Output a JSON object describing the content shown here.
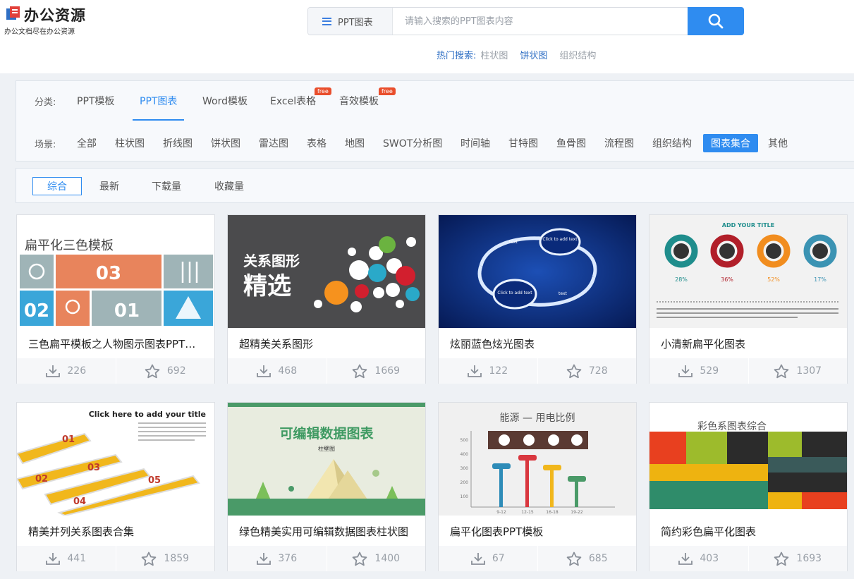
{
  "site": {
    "name": "办公资源",
    "slogan": "办公文档尽在办公资源"
  },
  "search": {
    "category": "PPT图表",
    "placeholder": "请输入搜索的PPT图表内容"
  },
  "hot": {
    "label": "热门搜索:",
    "items": [
      "柱状图",
      "饼状图",
      "组织结构"
    ],
    "active": "饼状图"
  },
  "filter": {
    "category_label": "分类:",
    "categories": [
      "PPT模板",
      "PPT图表",
      "Word模板",
      "Excel表格",
      "音效模板"
    ],
    "active_category": "PPT图表",
    "free_badge": "free",
    "scene_label": "场景:",
    "scenes": [
      "全部",
      "柱状图",
      "折线图",
      "饼状图",
      "雷达图",
      "表格",
      "地图",
      "SWOT分析图",
      "时间轴",
      "甘特图",
      "鱼骨图",
      "流程图",
      "组织结构",
      "图表集合",
      "其他"
    ],
    "active_scene": "图表集合"
  },
  "sort": {
    "options": [
      "综合",
      "最新",
      "下载量",
      "收藏量"
    ],
    "active": "综合"
  },
  "cards": [
    {
      "title": "三色扁平模板之人物图示图表PPT模板",
      "downloads": "226",
      "favorites": "692",
      "thumb_text": [
        "扁平化三色模板",
        "03",
        "02",
        "01"
      ]
    },
    {
      "title": "超精美关系图形",
      "downloads": "468",
      "favorites": "1669",
      "thumb_text": [
        "关系图形",
        "精选"
      ]
    },
    {
      "title": "炫丽蓝色炫光图表",
      "downloads": "122",
      "favorites": "728",
      "thumb_text": [
        "Click to add text",
        "text",
        "Click to add text",
        "text"
      ]
    },
    {
      "title": "小清新扁平化图表",
      "downloads": "529",
      "favorites": "1307",
      "thumb_text": [
        "ADD YOUR TITLE",
        "28%",
        "36%",
        "52%",
        "17%"
      ]
    },
    {
      "title": "精美并列关系图表合集",
      "downloads": "441",
      "favorites": "1859",
      "thumb_text": [
        "Click here to add your title",
        "01",
        "02",
        "03",
        "04",
        "05"
      ]
    },
    {
      "title": "绿色精美实用可编辑数据图表柱状图",
      "downloads": "376",
      "favorites": "1400",
      "thumb_text": [
        "可编辑数据图表",
        "柱壁图"
      ]
    },
    {
      "title": "扁平化图表PPT模板",
      "downloads": "67",
      "favorites": "685",
      "thumb_text": [
        "能源 — 用电比例",
        "500",
        "400",
        "300",
        "200",
        "100",
        "9-12",
        "12-15",
        "16-18",
        "19-22"
      ]
    },
    {
      "title": "简约彩色扁平化图表",
      "downloads": "403",
      "favorites": "1693",
      "thumb_text": [
        "彩色系图表综合"
      ]
    }
  ],
  "colors": {
    "accent": "#2f8cf0",
    "free_badge": "#e94e2c"
  }
}
